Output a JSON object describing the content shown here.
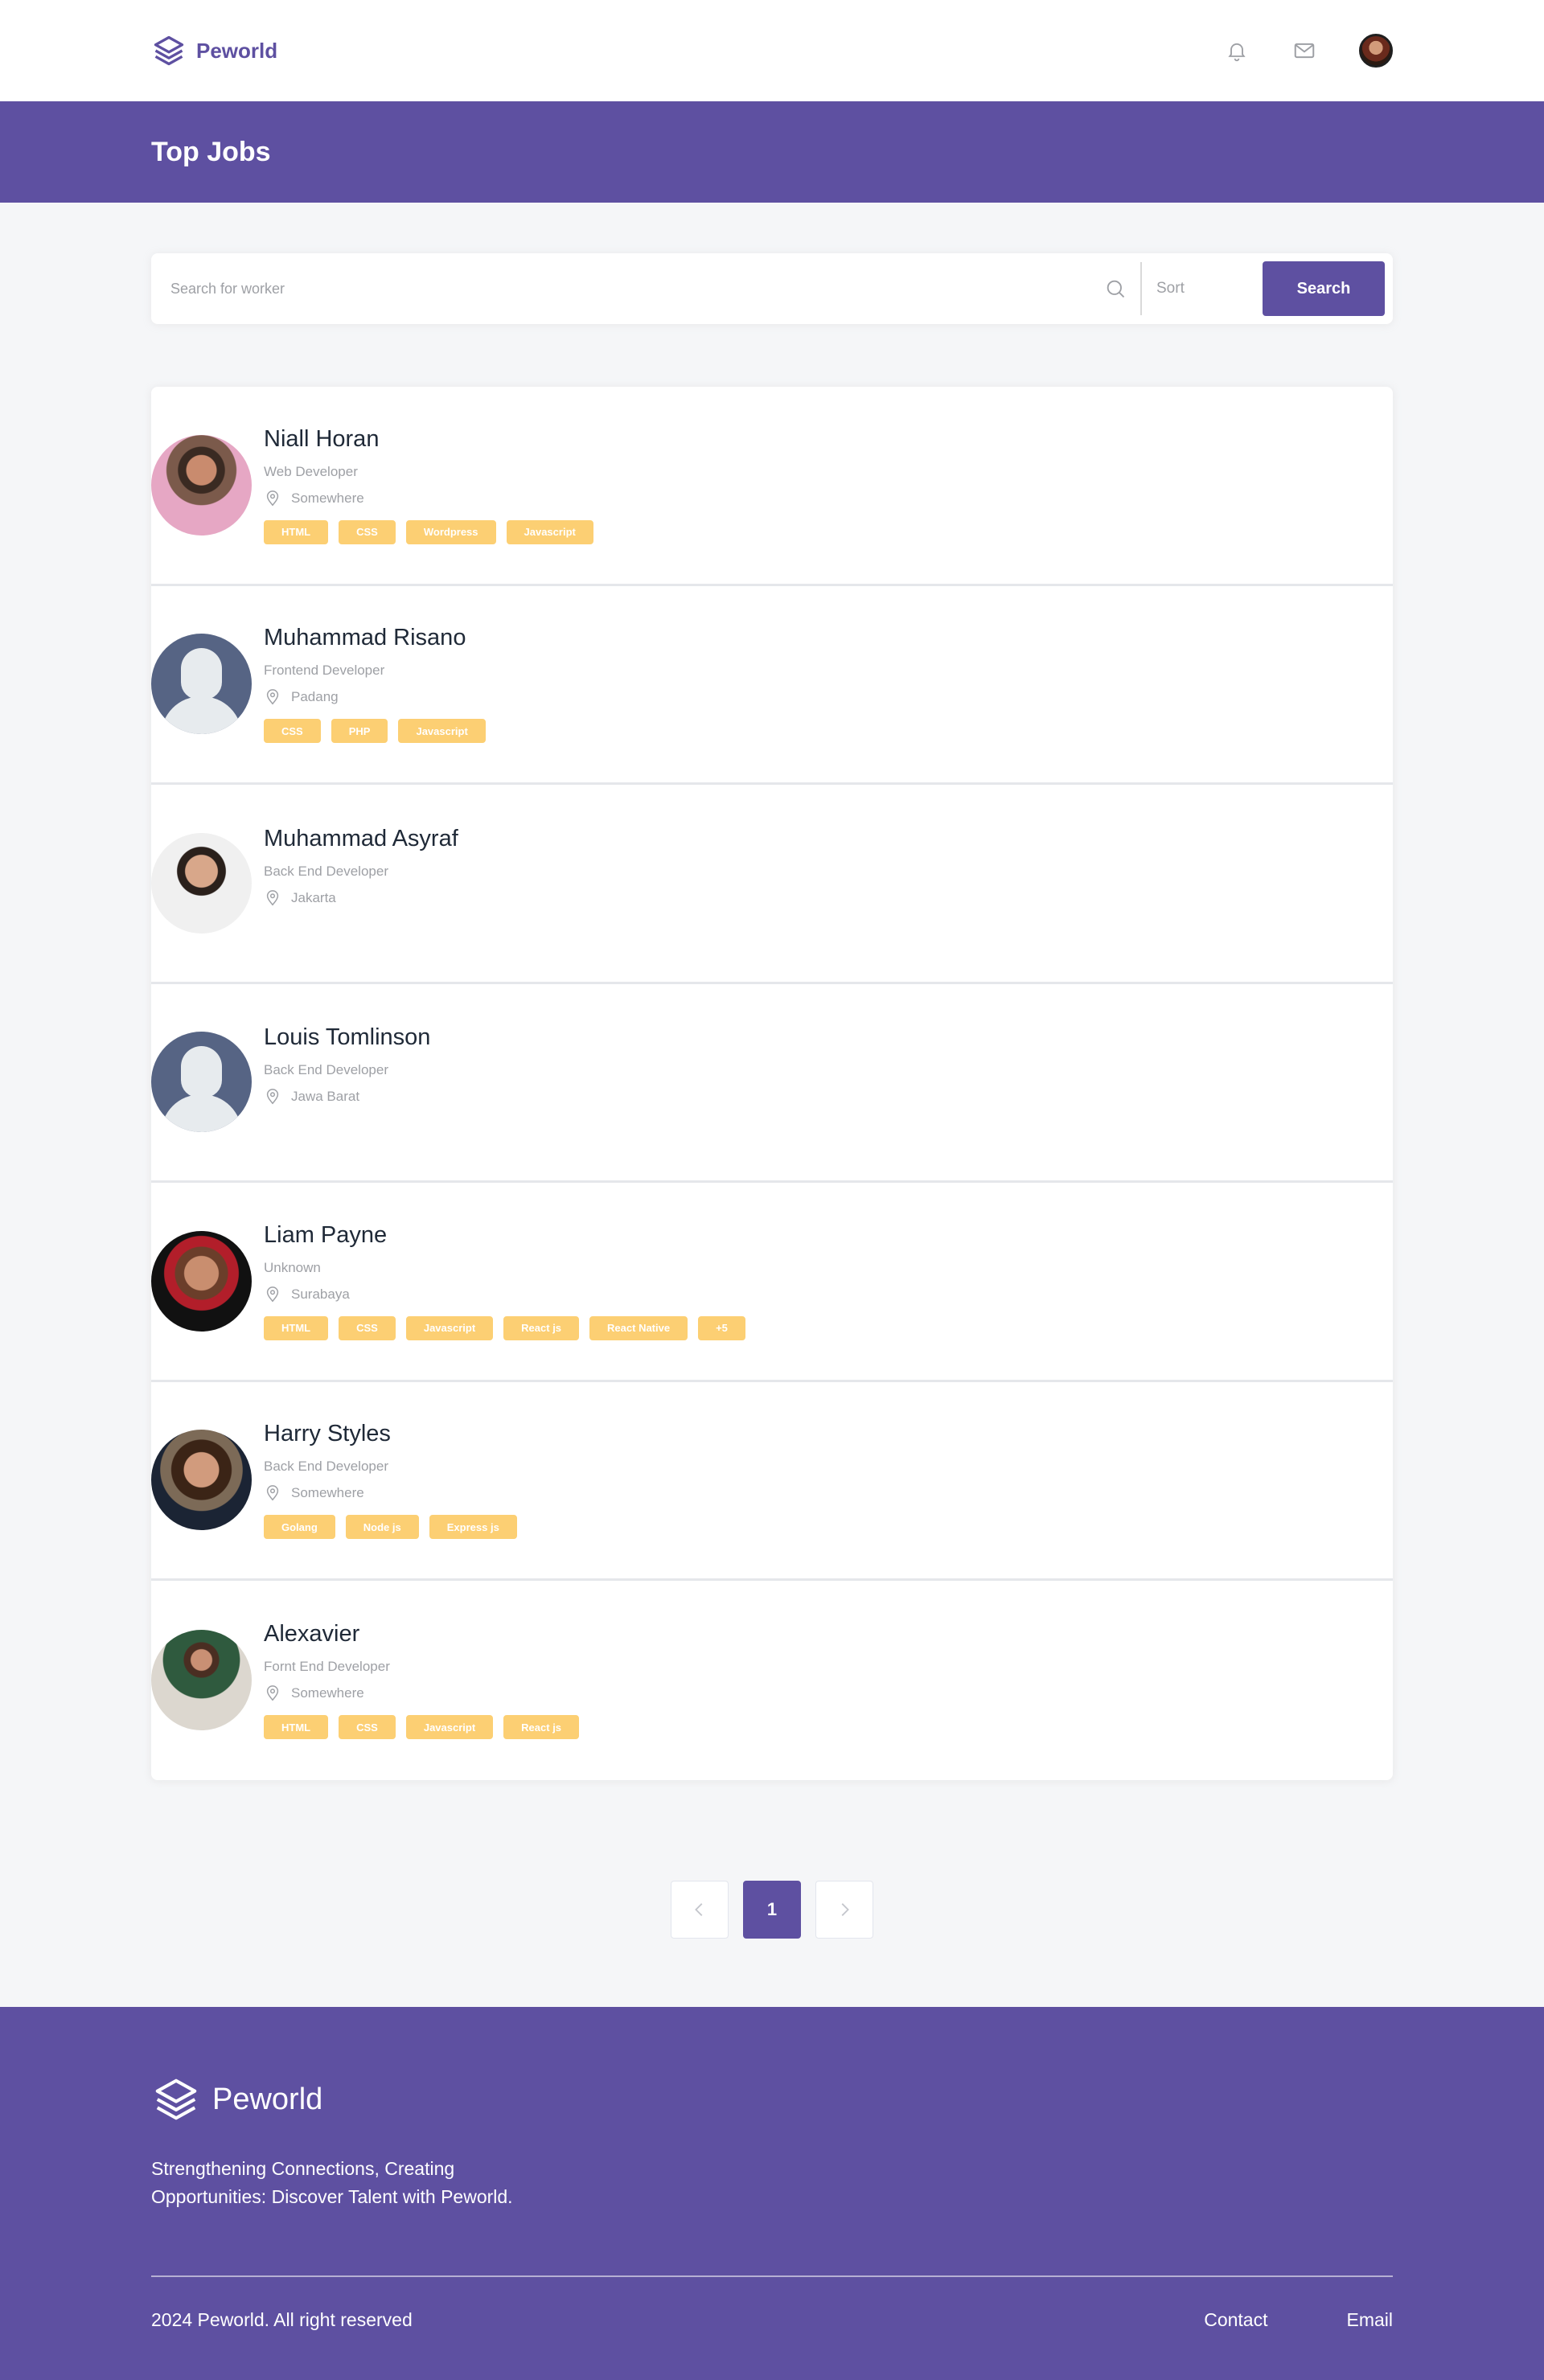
{
  "brand": {
    "name": "Peworld"
  },
  "nav": {
    "icons": [
      "bell-icon",
      "mail-icon"
    ]
  },
  "header": {
    "title": "Top Jobs"
  },
  "search": {
    "placeholder": "Search for worker",
    "sort_label": "Sort",
    "button_label": "Search"
  },
  "workers": [
    {
      "name": "Niall Horan",
      "role": "Web Developer",
      "location": "Somewhere",
      "tags": [
        "HTML",
        "CSS",
        "Wordpress",
        "Javascript"
      ]
    },
    {
      "name": "Muhammad Risano",
      "role": "Frontend Developer",
      "location": "Padang",
      "tags": [
        "CSS",
        "PHP",
        "Javascript"
      ]
    },
    {
      "name": "Muhammad Asyraf",
      "role": "Back End Developer",
      "location": "Jakarta",
      "tags": []
    },
    {
      "name": "Louis Tomlinson",
      "role": "Back End Developer",
      "location": "Jawa Barat",
      "tags": []
    },
    {
      "name": "Liam Payne",
      "role": "Unknown",
      "location": "Surabaya",
      "tags": [
        "HTML",
        "CSS",
        "Javascript",
        "React js",
        "React Native",
        "+5"
      ]
    },
    {
      "name": "Harry Styles",
      "role": "Back End Developer",
      "location": "Somewhere",
      "tags": [
        "Golang",
        "Node js",
        "Express js"
      ]
    },
    {
      "name": "Alexavier",
      "role": "Fornt End Developer",
      "location": "Somewhere",
      "tags": [
        "HTML",
        "CSS",
        "Javascript",
        "React js"
      ]
    }
  ],
  "pagination": {
    "current": "1",
    "prev_icon": "chevron-left-icon",
    "next_icon": "chevron-right-icon"
  },
  "footer": {
    "brand": "Peworld",
    "tagline": "Strengthening Connections, Creating Opportunities: Discover Talent with Peworld.",
    "copyright": "2024 Peworld. All right reserved",
    "links": [
      "Contact",
      "Email"
    ]
  },
  "colors": {
    "primary": "#5E50A1",
    "tag": "#FBB017",
    "background": "#F5F6F8",
    "muted": "#9EA0A5"
  }
}
